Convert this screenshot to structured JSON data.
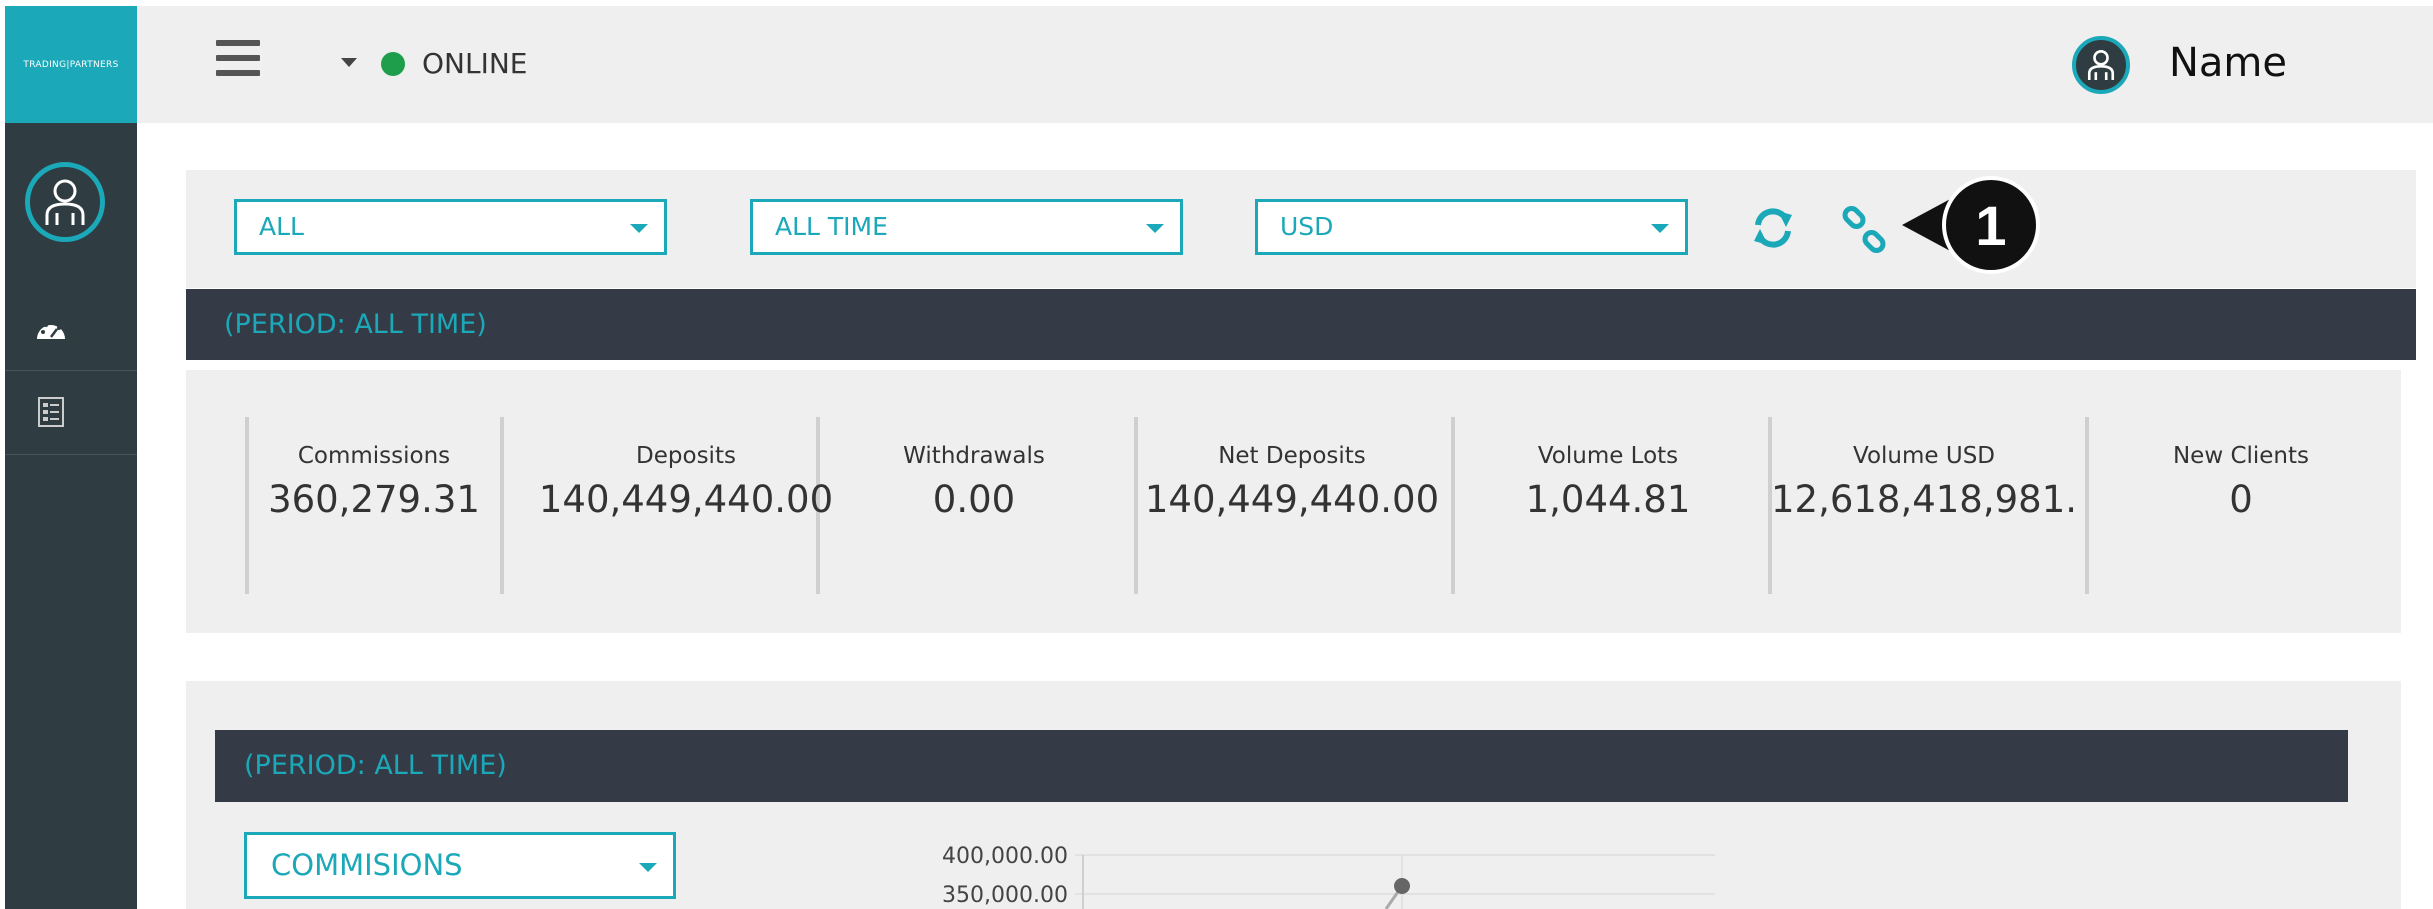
{
  "brand": {
    "name": "TRADING|PARTNERS"
  },
  "header": {
    "status_text": "ONLINE",
    "user_name": "Name"
  },
  "filters": {
    "account": {
      "selected": "ALL"
    },
    "period": {
      "selected": "ALL TIME"
    },
    "currency": {
      "selected": "USD"
    }
  },
  "callout": {
    "number": "1"
  },
  "summary": {
    "period_label": "(PERIOD: ALL TIME)",
    "stats": [
      {
        "label": "Commissions",
        "value": "360,279.31"
      },
      {
        "label": "Deposits",
        "value": "140,449,440.00"
      },
      {
        "label": "Withdrawals",
        "value": "0.00"
      },
      {
        "label": "Net Deposits",
        "value": "140,449,440.00"
      },
      {
        "label": "Volume Lots",
        "value": "1,044.81"
      },
      {
        "label": "Volume USD",
        "value": "12,618,418,981."
      },
      {
        "label": "New Clients",
        "value": "0"
      }
    ]
  },
  "chart_section": {
    "period_label": "(PERIOD: ALL TIME)",
    "metric_selected": "COMMISIONS"
  },
  "chart_data": {
    "type": "line",
    "title": "",
    "xlabel": "",
    "ylabel": "",
    "y_ticks": [
      "400,000.00",
      "350,000.00"
    ],
    "ylim": [
      300000,
      400000
    ],
    "series": [
      {
        "values": [
          360279.31
        ]
      }
    ]
  },
  "colors": {
    "accent": "#1ba8b8",
    "sidebar": "#2f3d42",
    "dark_bar": "#343b46",
    "online": "#1e9e4a"
  }
}
